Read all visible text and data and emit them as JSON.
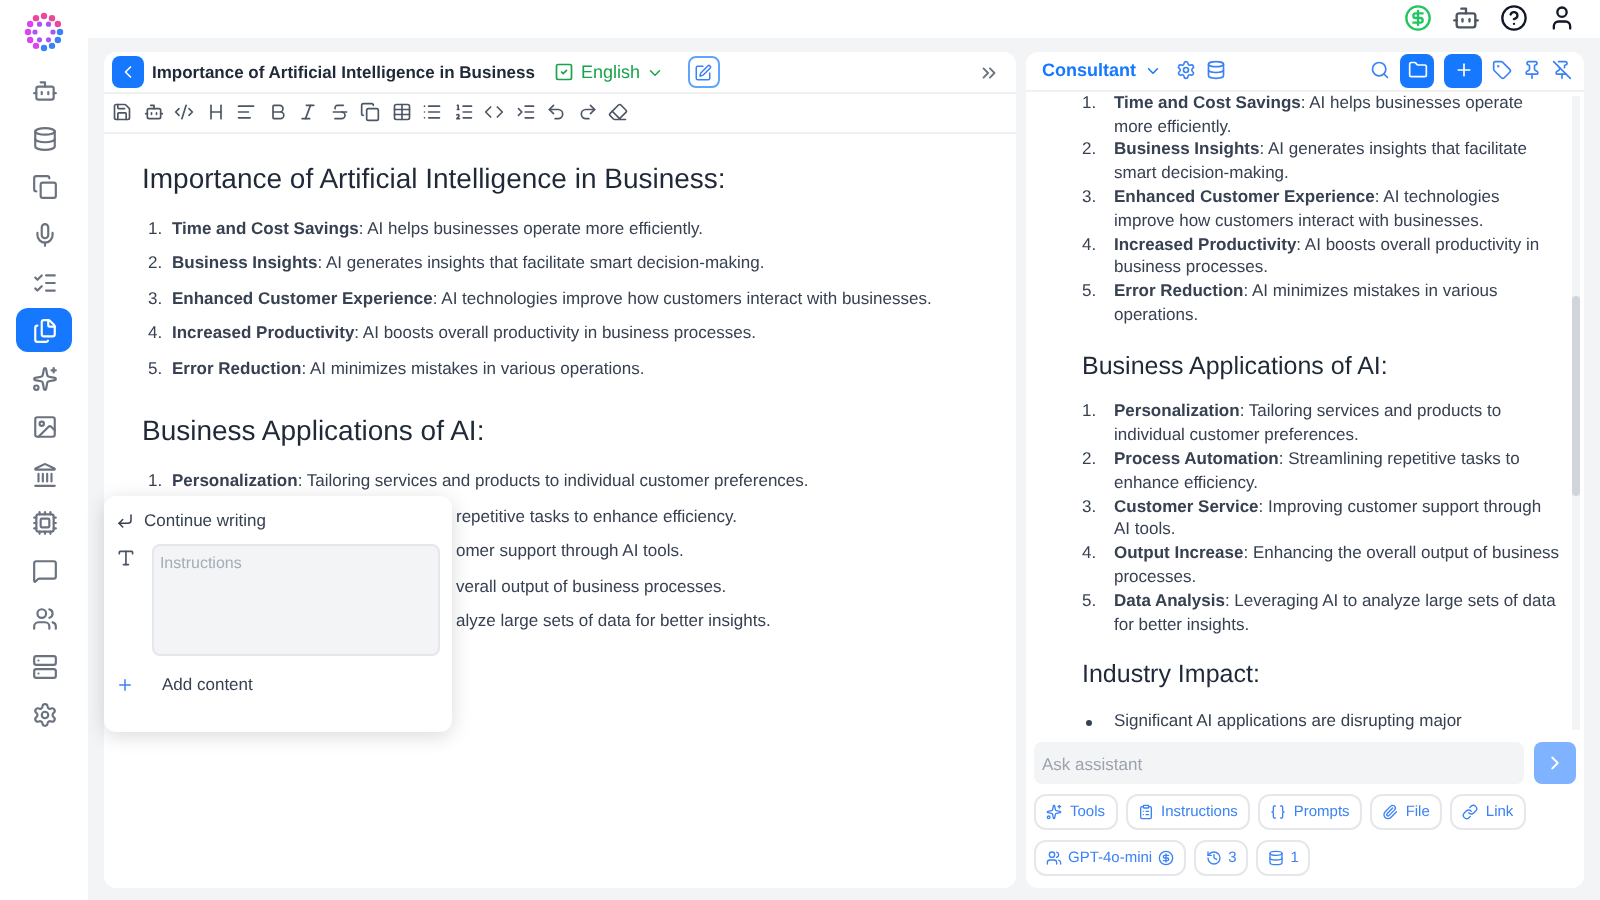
{
  "sidebar": {
    "items": [
      {
        "selected": false
      },
      {
        "selected": false
      },
      {
        "selected": false
      },
      {
        "selected": false
      },
      {
        "selected": false
      },
      {
        "selected": true
      },
      {
        "selected": false
      },
      {
        "selected": false
      },
      {
        "selected": false
      },
      {
        "selected": false
      },
      {
        "selected": false
      },
      {
        "selected": false
      },
      {
        "selected": false
      },
      {
        "selected": false
      }
    ]
  },
  "editor": {
    "title": "Importance of Artificial Intelligence in Business",
    "language": "English",
    "sections": [
      {
        "heading": "Importance of Artificial Intelligence in Business:",
        "items": [
          {
            "kind": "full",
            "number": "1.",
            "text": "**Time and Cost Savings**: AI helps businesses operate more efficiently."
          },
          {
            "kind": "full",
            "number": "2.",
            "text": "**Business Insights**: AI generates insights that facilitate smart decision-making."
          },
          {
            "kind": "full",
            "number": "3.",
            "text": "**Enhanced Customer Experience**: AI technologies improve how customers interact with businesses."
          },
          {
            "kind": "full",
            "number": "4.",
            "text": "**Increased Productivity**: AI boosts overall productivity in business processes."
          },
          {
            "kind": "full",
            "number": "5.",
            "text": "**Error Reduction**: AI minimizes mistakes in various operations."
          }
        ]
      },
      {
        "heading": "Business Applications of AI:",
        "items": [
          {
            "kind": "full",
            "number": "1.",
            "text": "**Personalization**: Tailoring services and products to individual customer preferences."
          },
          {
            "kind": "covered",
            "text": "repetitive tasks to enhance efficiency."
          },
          {
            "kind": "covered",
            "text": "omer support through AI tools."
          },
          {
            "kind": "covered",
            "text": "verall output of business processes."
          },
          {
            "kind": "covered",
            "text": "alyze large sets of data for better insights."
          }
        ]
      }
    ]
  },
  "popup": {
    "action": "Continue writing",
    "placeholder": "Instructions",
    "add_label": "Add content"
  },
  "assistant": {
    "agent": "Consultant",
    "sections": [
      {
        "kind": "numbered",
        "items": [
          {
            "number": "1.",
            "text": "**Time and Cost Savings**: AI helps businesses operate more efficiently."
          },
          {
            "number": "2.",
            "text": "**Business Insights**: AI generates insights that facilitate smart decision-making."
          },
          {
            "number": "3.",
            "text": "**Enhanced Customer Experience**: AI technologies improve how customers interact with businesses."
          },
          {
            "number": "4.",
            "text": "**Increased Productivity**: AI boosts overall productivity in business processes."
          },
          {
            "number": "5.",
            "text": "**Error Reduction**: AI minimizes mistakes in various operations."
          }
        ]
      },
      {
        "kind": "numbered",
        "heading": "Business Applications of AI:",
        "items": [
          {
            "number": "1.",
            "text": "**Personalization**: Tailoring services and products to individual customer preferences."
          },
          {
            "number": "2.",
            "text": "**Process Automation**: Streamlining repetitive tasks to enhance efficiency."
          },
          {
            "number": "3.",
            "text": "**Customer Service**: Improving customer support through AI tools."
          },
          {
            "number": "4.",
            "text": "**Output Increase**: Enhancing the overall output of business processes."
          },
          {
            "number": "5.",
            "text": "**Data Analysis**: Leveraging AI to analyze large sets of data for better insights."
          }
        ]
      },
      {
        "kind": "bulleted",
        "heading": "Industry Impact:",
        "items": [
          {
            "text": "Significant AI applications are disrupting major"
          }
        ]
      }
    ],
    "input": {
      "placeholder": "Ask assistant"
    },
    "chips": [
      "Tools",
      "Instructions",
      "Prompts",
      "File",
      "Link"
    ],
    "model": "GPT-4o-mini",
    "history_count": "3",
    "source_count": "1"
  }
}
